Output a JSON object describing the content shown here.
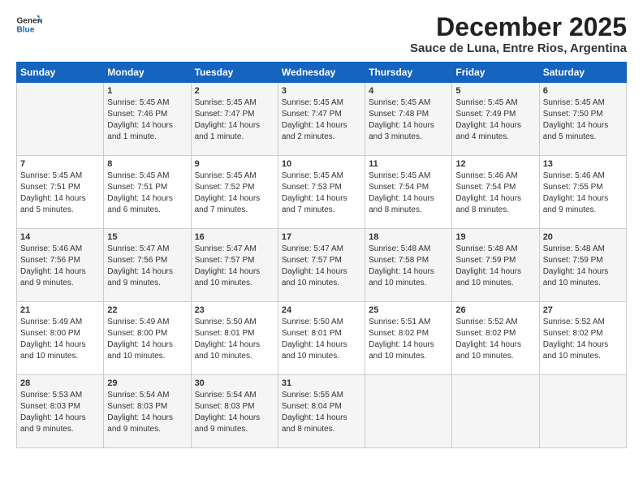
{
  "logo": {
    "line1": "General",
    "line2": "Blue"
  },
  "title": "December 2025",
  "location": "Sauce de Luna, Entre Rios, Argentina",
  "weekdays": [
    "Sunday",
    "Monday",
    "Tuesday",
    "Wednesday",
    "Thursday",
    "Friday",
    "Saturday"
  ],
  "weeks": [
    [
      {
        "day": "",
        "sunrise": "",
        "sunset": "",
        "daylight": ""
      },
      {
        "day": "1",
        "sunrise": "Sunrise: 5:45 AM",
        "sunset": "Sunset: 7:46 PM",
        "daylight": "Daylight: 14 hours and 1 minute."
      },
      {
        "day": "2",
        "sunrise": "Sunrise: 5:45 AM",
        "sunset": "Sunset: 7:47 PM",
        "daylight": "Daylight: 14 hours and 1 minute."
      },
      {
        "day": "3",
        "sunrise": "Sunrise: 5:45 AM",
        "sunset": "Sunset: 7:47 PM",
        "daylight": "Daylight: 14 hours and 2 minutes."
      },
      {
        "day": "4",
        "sunrise": "Sunrise: 5:45 AM",
        "sunset": "Sunset: 7:48 PM",
        "daylight": "Daylight: 14 hours and 3 minutes."
      },
      {
        "day": "5",
        "sunrise": "Sunrise: 5:45 AM",
        "sunset": "Sunset: 7:49 PM",
        "daylight": "Daylight: 14 hours and 4 minutes."
      },
      {
        "day": "6",
        "sunrise": "Sunrise: 5:45 AM",
        "sunset": "Sunset: 7:50 PM",
        "daylight": "Daylight: 14 hours and 5 minutes."
      }
    ],
    [
      {
        "day": "7",
        "sunrise": "Sunrise: 5:45 AM",
        "sunset": "Sunset: 7:51 PM",
        "daylight": "Daylight: 14 hours and 5 minutes."
      },
      {
        "day": "8",
        "sunrise": "Sunrise: 5:45 AM",
        "sunset": "Sunset: 7:51 PM",
        "daylight": "Daylight: 14 hours and 6 minutes."
      },
      {
        "day": "9",
        "sunrise": "Sunrise: 5:45 AM",
        "sunset": "Sunset: 7:52 PM",
        "daylight": "Daylight: 14 hours and 7 minutes."
      },
      {
        "day": "10",
        "sunrise": "Sunrise: 5:45 AM",
        "sunset": "Sunset: 7:53 PM",
        "daylight": "Daylight: 14 hours and 7 minutes."
      },
      {
        "day": "11",
        "sunrise": "Sunrise: 5:45 AM",
        "sunset": "Sunset: 7:54 PM",
        "daylight": "Daylight: 14 hours and 8 minutes."
      },
      {
        "day": "12",
        "sunrise": "Sunrise: 5:46 AM",
        "sunset": "Sunset: 7:54 PM",
        "daylight": "Daylight: 14 hours and 8 minutes."
      },
      {
        "day": "13",
        "sunrise": "Sunrise: 5:46 AM",
        "sunset": "Sunset: 7:55 PM",
        "daylight": "Daylight: 14 hours and 9 minutes."
      }
    ],
    [
      {
        "day": "14",
        "sunrise": "Sunrise: 5:46 AM",
        "sunset": "Sunset: 7:56 PM",
        "daylight": "Daylight: 14 hours and 9 minutes."
      },
      {
        "day": "15",
        "sunrise": "Sunrise: 5:47 AM",
        "sunset": "Sunset: 7:56 PM",
        "daylight": "Daylight: 14 hours and 9 minutes."
      },
      {
        "day": "16",
        "sunrise": "Sunrise: 5:47 AM",
        "sunset": "Sunset: 7:57 PM",
        "daylight": "Daylight: 14 hours and 10 minutes."
      },
      {
        "day": "17",
        "sunrise": "Sunrise: 5:47 AM",
        "sunset": "Sunset: 7:57 PM",
        "daylight": "Daylight: 14 hours and 10 minutes."
      },
      {
        "day": "18",
        "sunrise": "Sunrise: 5:48 AM",
        "sunset": "Sunset: 7:58 PM",
        "daylight": "Daylight: 14 hours and 10 minutes."
      },
      {
        "day": "19",
        "sunrise": "Sunrise: 5:48 AM",
        "sunset": "Sunset: 7:59 PM",
        "daylight": "Daylight: 14 hours and 10 minutes."
      },
      {
        "day": "20",
        "sunrise": "Sunrise: 5:48 AM",
        "sunset": "Sunset: 7:59 PM",
        "daylight": "Daylight: 14 hours and 10 minutes."
      }
    ],
    [
      {
        "day": "21",
        "sunrise": "Sunrise: 5:49 AM",
        "sunset": "Sunset: 8:00 PM",
        "daylight": "Daylight: 14 hours and 10 minutes."
      },
      {
        "day": "22",
        "sunrise": "Sunrise: 5:49 AM",
        "sunset": "Sunset: 8:00 PM",
        "daylight": "Daylight: 14 hours and 10 minutes."
      },
      {
        "day": "23",
        "sunrise": "Sunrise: 5:50 AM",
        "sunset": "Sunset: 8:01 PM",
        "daylight": "Daylight: 14 hours and 10 minutes."
      },
      {
        "day": "24",
        "sunrise": "Sunrise: 5:50 AM",
        "sunset": "Sunset: 8:01 PM",
        "daylight": "Daylight: 14 hours and 10 minutes."
      },
      {
        "day": "25",
        "sunrise": "Sunrise: 5:51 AM",
        "sunset": "Sunset: 8:02 PM",
        "daylight": "Daylight: 14 hours and 10 minutes."
      },
      {
        "day": "26",
        "sunrise": "Sunrise: 5:52 AM",
        "sunset": "Sunset: 8:02 PM",
        "daylight": "Daylight: 14 hours and 10 minutes."
      },
      {
        "day": "27",
        "sunrise": "Sunrise: 5:52 AM",
        "sunset": "Sunset: 8:02 PM",
        "daylight": "Daylight: 14 hours and 10 minutes."
      }
    ],
    [
      {
        "day": "28",
        "sunrise": "Sunrise: 5:53 AM",
        "sunset": "Sunset: 8:03 PM",
        "daylight": "Daylight: 14 hours and 9 minutes."
      },
      {
        "day": "29",
        "sunrise": "Sunrise: 5:54 AM",
        "sunset": "Sunset: 8:03 PM",
        "daylight": "Daylight: 14 hours and 9 minutes."
      },
      {
        "day": "30",
        "sunrise": "Sunrise: 5:54 AM",
        "sunset": "Sunset: 8:03 PM",
        "daylight": "Daylight: 14 hours and 9 minutes."
      },
      {
        "day": "31",
        "sunrise": "Sunrise: 5:55 AM",
        "sunset": "Sunset: 8:04 PM",
        "daylight": "Daylight: 14 hours and 8 minutes."
      },
      {
        "day": "",
        "sunrise": "",
        "sunset": "",
        "daylight": ""
      },
      {
        "day": "",
        "sunrise": "",
        "sunset": "",
        "daylight": ""
      },
      {
        "day": "",
        "sunrise": "",
        "sunset": "",
        "daylight": ""
      }
    ]
  ]
}
